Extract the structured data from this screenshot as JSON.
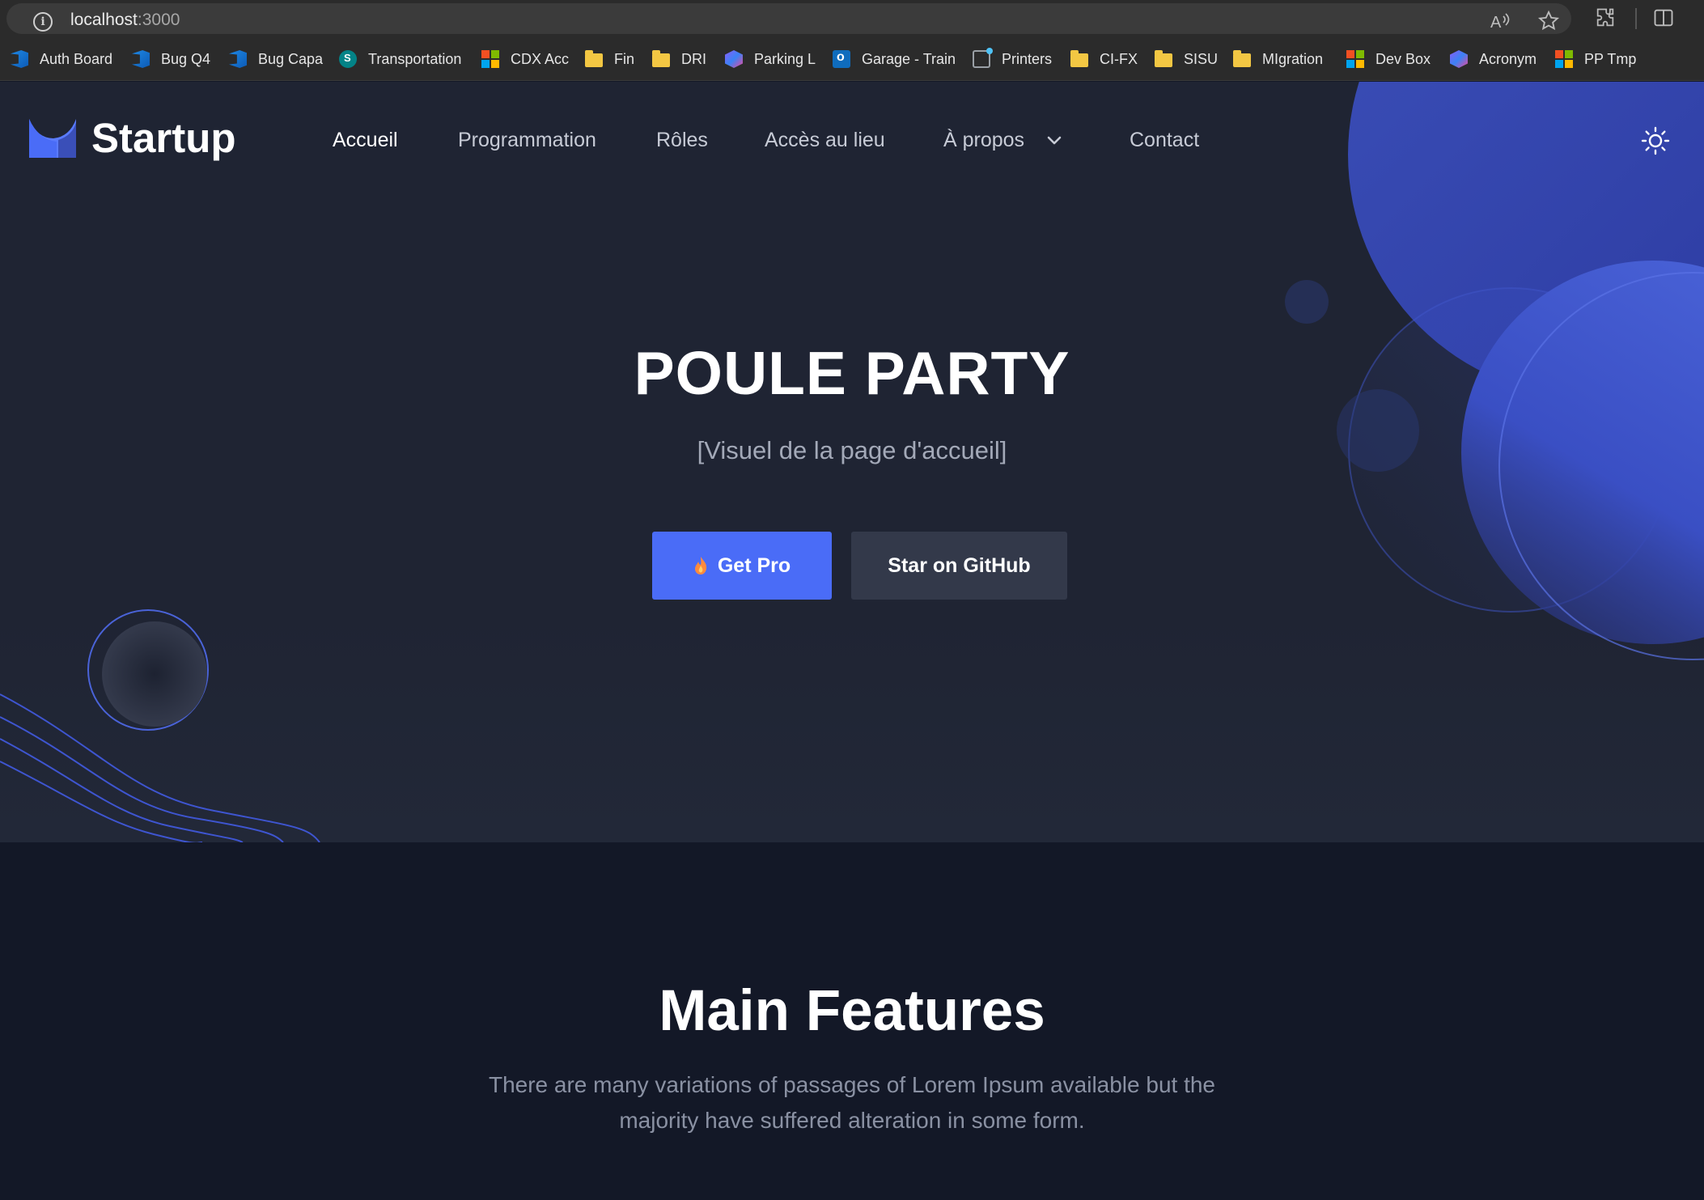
{
  "browser": {
    "url_host": "localhost",
    "url_port": ":3000",
    "bookmarks": [
      {
        "label": "Auth Board",
        "icon": "azure-devops-icon"
      },
      {
        "label": "Bug Q4",
        "icon": "azure-devops-icon"
      },
      {
        "label": "Bug Capa",
        "icon": "azure-devops-icon"
      },
      {
        "label": "Transportation",
        "icon": "sharepoint-icon"
      },
      {
        "label": "CDX Acc",
        "icon": "microsoft-icon"
      },
      {
        "label": "Fin",
        "icon": "folder-icon"
      },
      {
        "label": "DRI",
        "icon": "folder-icon"
      },
      {
        "label": "Parking L",
        "icon": "app-icon"
      },
      {
        "label": "Garage - Train",
        "icon": "outlook-icon"
      },
      {
        "label": "Printers",
        "icon": "printer-icon"
      },
      {
        "label": "CI-FX",
        "icon": "folder-icon"
      },
      {
        "label": "SISU",
        "icon": "folder-icon"
      },
      {
        "label": "MIgration",
        "icon": "folder-icon"
      },
      {
        "label": "Dev Box",
        "icon": "microsoft-icon"
      },
      {
        "label": "Acronym",
        "icon": "app-icon"
      },
      {
        "label": "PP Tmp",
        "icon": "microsoft-icon"
      }
    ]
  },
  "header": {
    "brand": "Startup",
    "nav": [
      {
        "label": "Accueil",
        "active": true
      },
      {
        "label": "Programmation",
        "active": false
      },
      {
        "label": "Rôles",
        "active": false
      },
      {
        "label": "Accès au lieu",
        "active": false
      },
      {
        "label": "À propos",
        "active": false,
        "dropdown": true
      },
      {
        "label": "Contact",
        "active": false
      }
    ],
    "theme_toggle_icon": "sun-icon"
  },
  "hero": {
    "title": "POULE PARTY",
    "subtitle": "[Visuel de la page d'accueil]",
    "primary_button": "Get Pro",
    "secondary_button": "Star on GitHub"
  },
  "features": {
    "title": "Main Features",
    "description": "There are many variations of passages of Lorem Ipsum available but the majority have suffered alteration in some form."
  },
  "colors": {
    "accent": "#4a6cf7",
    "hero_bg": "#1f2433",
    "section_bg": "#131827",
    "secondary_button": "#33394a"
  }
}
